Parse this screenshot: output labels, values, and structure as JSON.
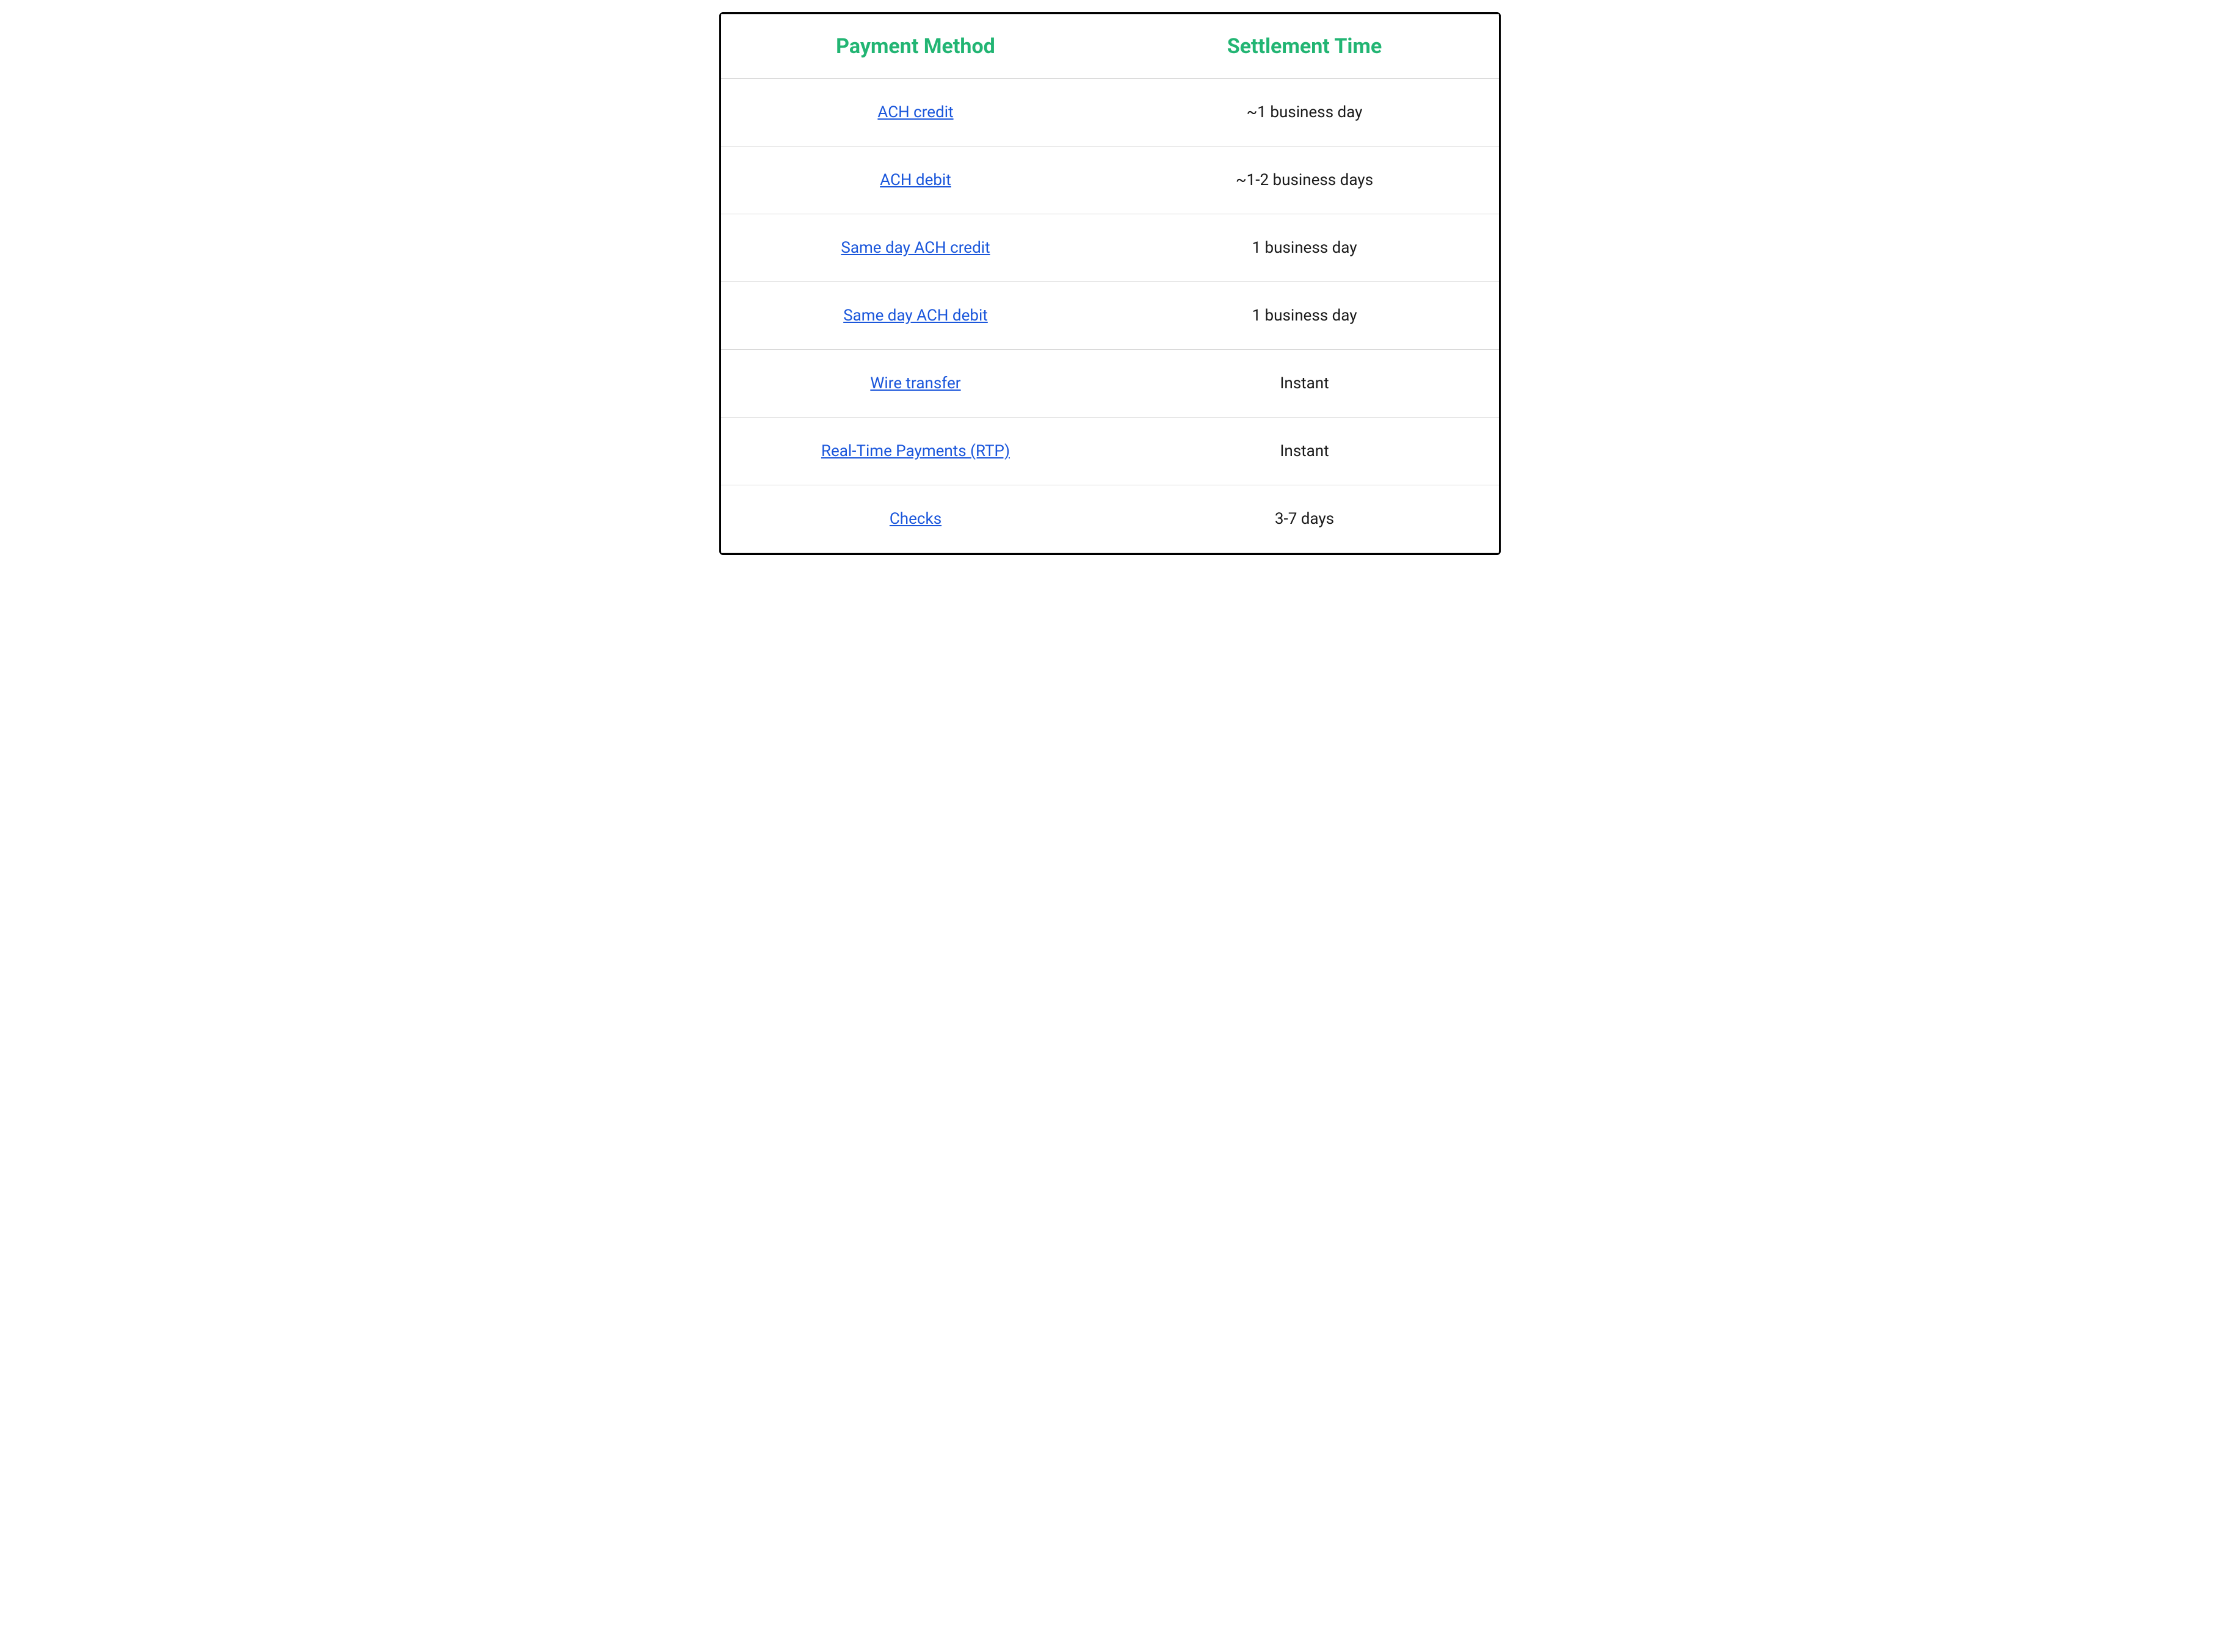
{
  "table": {
    "headers": {
      "method": "Payment Method",
      "settlement": "Settlement Time"
    },
    "rows": [
      {
        "method": "ACH credit",
        "settlement": "~1 business day"
      },
      {
        "method": "ACH debit",
        "settlement": "~1-2 business days"
      },
      {
        "method": "Same day ACH credit",
        "settlement": "1 business day"
      },
      {
        "method": "Same day ACH debit",
        "settlement": "1 business day"
      },
      {
        "method": "Wire transfer",
        "settlement": "Instant"
      },
      {
        "method": "Real-Time Payments (RTP)",
        "settlement": "Instant"
      },
      {
        "method": "Checks",
        "settlement": "3-7 days"
      }
    ]
  }
}
